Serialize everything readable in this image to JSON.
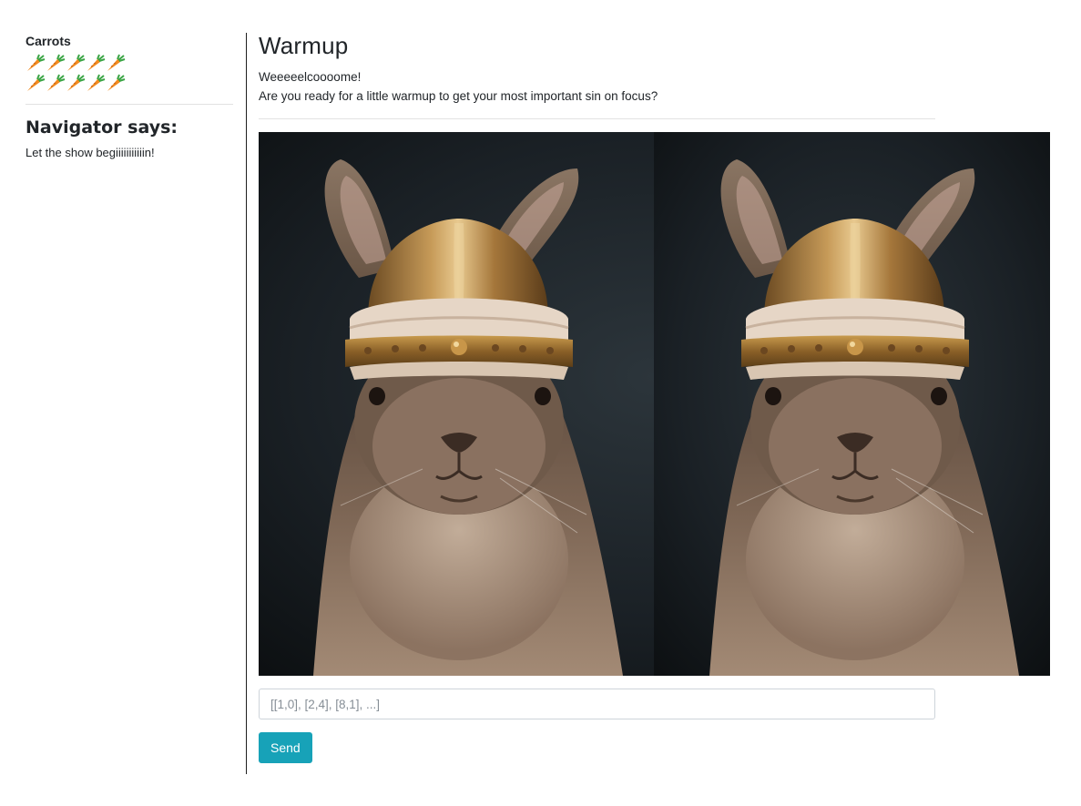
{
  "sidebar": {
    "carrots_title": "Carrots",
    "carrot_count": 10,
    "carrot_icon": "carrot-icon",
    "navigator_title": "Navigator says:",
    "navigator_text": "Let the show begiiiiiiiiiiin!"
  },
  "main": {
    "title": "Warmup",
    "intro_line_1": "Weeeeelcoooome!",
    "intro_line_2": "Are you ready for a little warmup to get your most important sin on focus?",
    "image_alt_icon": "viking-rabbit-photo",
    "answer_placeholder": "[[1,0], [2,4], [8,1], ...]",
    "send_label": "Send"
  },
  "colors": {
    "accent": "#17a2b8",
    "carrot_orange": "#f28a1e",
    "carrot_green": "#3aa545",
    "separator": "#1e1e1e"
  }
}
